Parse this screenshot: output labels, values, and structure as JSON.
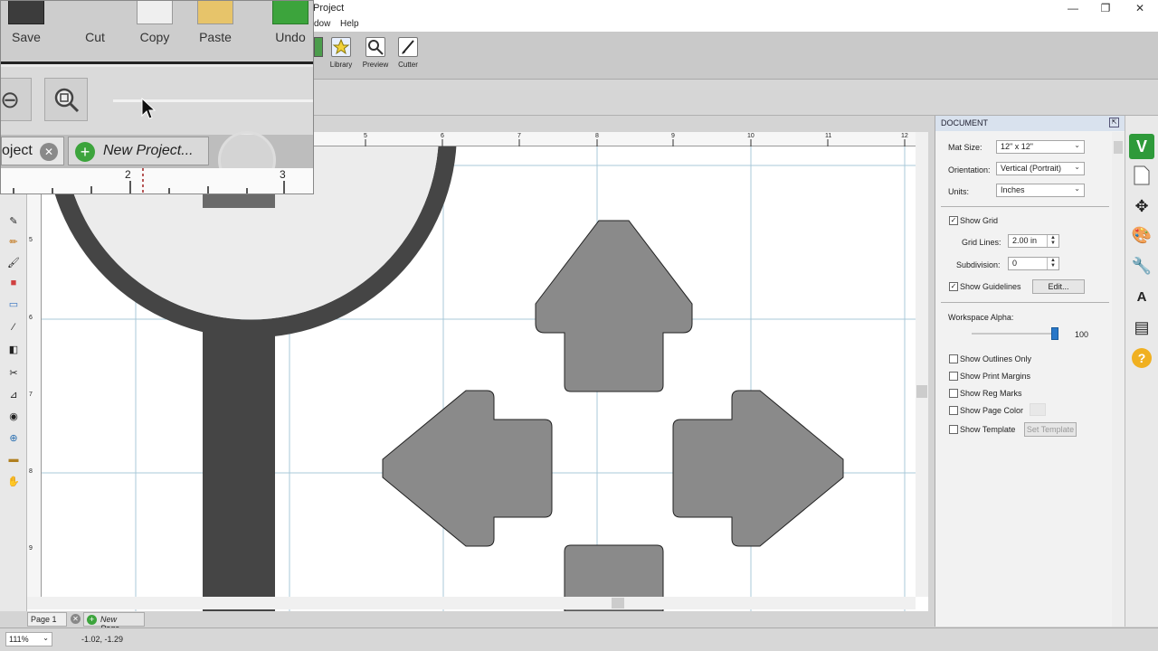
{
  "titlebar": {
    "title": "Project",
    "min": "—",
    "max": "❐",
    "close": "✕"
  },
  "menu": {
    "window_partial": "dow",
    "help": "Help"
  },
  "toolbar": {
    "items": [
      {
        "label": "Library"
      },
      {
        "label": "Preview"
      },
      {
        "label": "Cutter"
      }
    ]
  },
  "overlay": {
    "buttons": [
      "Save",
      "Cut",
      "Copy",
      "Paste",
      "Undo"
    ],
    "tab_project": "oject",
    "tab_new_project": "New Project...",
    "ruler_labels": [
      "2",
      "3"
    ]
  },
  "hruler_labels": [
    "5",
    "6",
    "7",
    "8",
    "9",
    "10",
    "11",
    "12"
  ],
  "vruler_labels": [
    "5",
    "6",
    "7",
    "8",
    "9"
  ],
  "panel": {
    "title": "DOCUMENT",
    "mat_size_label": "Mat Size:",
    "mat_size_value": "12\" x 12\"",
    "orientation_label": "Orientation:",
    "orientation_value": "Vertical (Portrait)",
    "units_label": "Units:",
    "units_value": "Inches",
    "show_grid": "Show Grid",
    "grid_lines_label": "Grid Lines:",
    "grid_lines_value": "2.00 in",
    "subdivision_label": "Subdivision:",
    "subdivision_value": "0",
    "show_guidelines": "Show Guidelines",
    "edit_button": "Edit...",
    "workspace_alpha_label": "Workspace Alpha:",
    "workspace_alpha_value": "100",
    "show_outlines_only": "Show Outlines Only",
    "show_print_margins": "Show Print Margins",
    "show_reg_marks": "Show Reg Marks",
    "show_page_color": "Show Page Color",
    "show_template": "Show Template",
    "set_template": "Set Template"
  },
  "page_tabs": {
    "page1": "Page 1",
    "new_page": "New Page..."
  },
  "status": {
    "zoom": "111%",
    "coords": "-1.02, -1.29"
  },
  "colors": {
    "shape_fill": "#8a8a8a",
    "accent_green": "#3ca43c",
    "grid_line": "#a8c8d8"
  }
}
